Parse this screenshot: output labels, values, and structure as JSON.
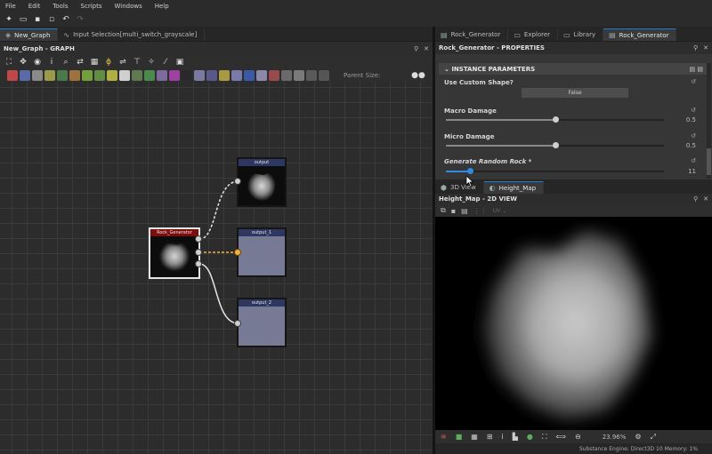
{
  "menu": [
    "File",
    "Edit",
    "Tools",
    "Scripts",
    "Windows",
    "Help"
  ],
  "left_tabs": [
    {
      "label": "New_Graph",
      "active": true
    },
    {
      "label": "Input Selection[multi_switch_grayscale]",
      "active": false
    }
  ],
  "right_tabs": [
    {
      "label": "Rock_Generator",
      "active": false
    },
    {
      "label": "Explorer",
      "active": false
    },
    {
      "label": "Library",
      "active": false
    },
    {
      "label": "Rock_Generator",
      "active": true
    }
  ],
  "graph": {
    "title": "New_Graph - GRAPH",
    "parent_size_label": "Parent Size:",
    "nodes": {
      "generator": "Rock_Generator",
      "output": "output",
      "output1": "output_1",
      "output2": "output_2"
    }
  },
  "properties": {
    "title": "Rock_Generator - PROPERTIES",
    "section": "INSTANCE PARAMETERS",
    "use_custom_shape": {
      "label": "Use Custom Shape?",
      "value": "False"
    },
    "macro_damage": {
      "label": "Macro Damage",
      "value": "0.5",
      "fraction": 0.5
    },
    "micro_damage": {
      "label": "Micro Damage",
      "value": "0.5",
      "fraction": 0.5
    },
    "generate_random_rock": {
      "label": "Generate Random Rock *",
      "value": "11",
      "fraction": 0.11
    }
  },
  "view_tabs": [
    {
      "label": "3D View",
      "active": false
    },
    {
      "label": "Height_Map",
      "active": true
    }
  ],
  "view2d": {
    "title": "Height_Map - 2D VIEW",
    "uv_label": "UV",
    "zoom": "23.96%",
    "status": "Substance Engine: Direct3D 10  Memory: 1%"
  },
  "colors": {
    "accent": "#1f7bd6",
    "generator_header": "#7d0d0d",
    "output_header": "#2e3760",
    "highlight_port": "#f0b33a"
  }
}
